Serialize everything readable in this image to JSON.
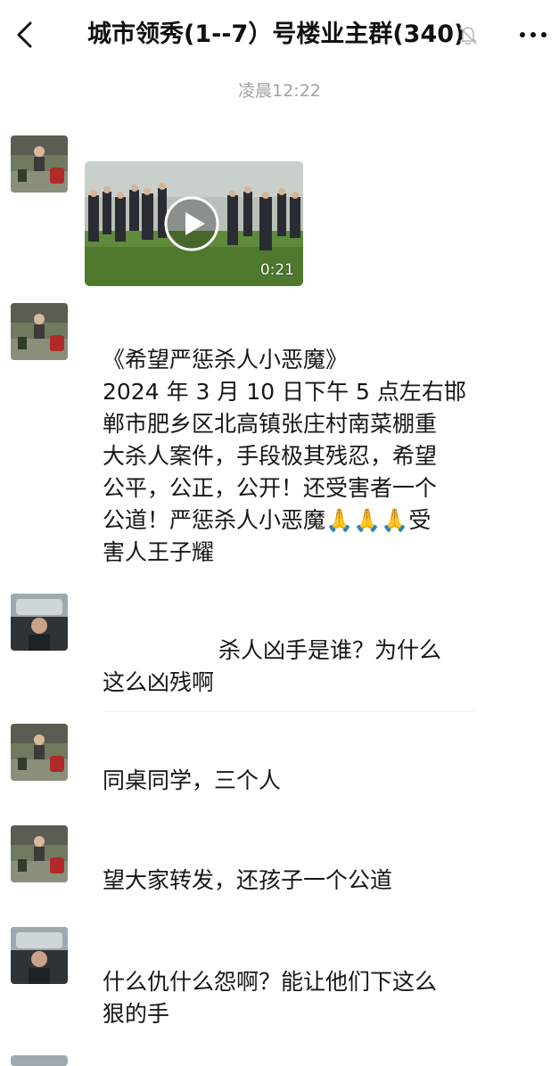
{
  "header": {
    "title": "城市领秀(1--7）号楼业主群(340)",
    "back_icon": "chevron-left-icon",
    "mute_icon": "bell-muted-icon",
    "more_icon": "ellipsis-icon"
  },
  "timestamp": "凌晨12:22",
  "video": {
    "duration": "0:21"
  },
  "messages": {
    "m2": {
      "lines": [
        "《希望严惩杀人小恶魔》",
        "2024 年 3 月 10 日下午 5 点左右邯",
        "郸市肥乡区北高镇张庄村南菜棚重",
        "大杀人案件，手段极其残忍，希望",
        "公平，公正，公开！还受害者一个",
        "公道！严惩杀人小恶魔🙏🙏🙏受",
        "害人王子耀"
      ]
    },
    "m3": {
      "lines": [
        "杀人凶手是谁？为什么",
        "这么凶残啊"
      ]
    },
    "m4": {
      "lines": [
        "同桌同学，三个人"
      ]
    },
    "m5": {
      "lines": [
        "望大家转发，还孩子一个公道"
      ]
    },
    "m6": {
      "lines": [
        "什么仇什么怨啊？能让他们下这么",
        "狠的手"
      ]
    }
  },
  "colors": {
    "timestamp": "#a0a0a0",
    "text": "#161616",
    "background": "#ffffff"
  }
}
